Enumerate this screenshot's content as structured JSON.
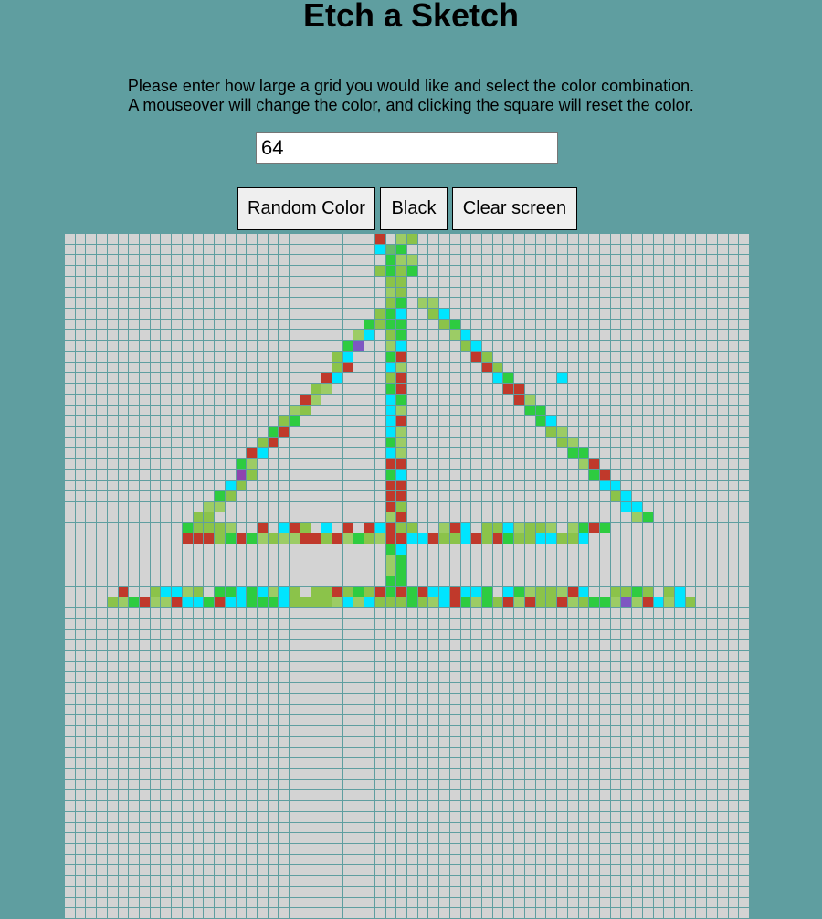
{
  "header": {
    "title": "Etch a Sketch"
  },
  "instructions": {
    "line1": "Please enter how large a grid you would like and select the color combination.",
    "line2": "A mouseover will change the color, and clicking the square will reset the color."
  },
  "grid_size_input": {
    "value": "64"
  },
  "toolbar": {
    "random_color_label": "Random Color",
    "black_label": "Black",
    "clear_label": "Clear screen"
  },
  "grid": {
    "size": 64,
    "cell_color": "#d3d3d3",
    "line_color": "#5f9ea0",
    "palette": [
      "#2ecc40",
      "#8e44ad",
      "#34a853",
      "#1abc9c",
      "#e91e63",
      "#9b59b6",
      "#3498db",
      "#f1c40f",
      "#c0392b",
      "#16a085",
      "#27ae60",
      "#e67e22",
      "#2c3e50",
      "#7f8c8d",
      "#6a1b9a",
      "#00bcd4",
      "#8bc34a",
      "#d81b60",
      "#5c6bc0",
      "#26a69a",
      "#795548",
      "#ff7043",
      "#4a6572",
      "#a1887f",
      "#00e5ff",
      "#b388ff",
      "#43a047",
      "#1565c0",
      "#ad1457",
      "#558b2f",
      "#f06292",
      "#4db6ac",
      "#9ccc65",
      "#7e57c2",
      "#ef5350",
      "#29b6f6",
      "#66bb6a",
      "#ffa726",
      "#8d6e63",
      "#26c6da"
    ]
  }
}
